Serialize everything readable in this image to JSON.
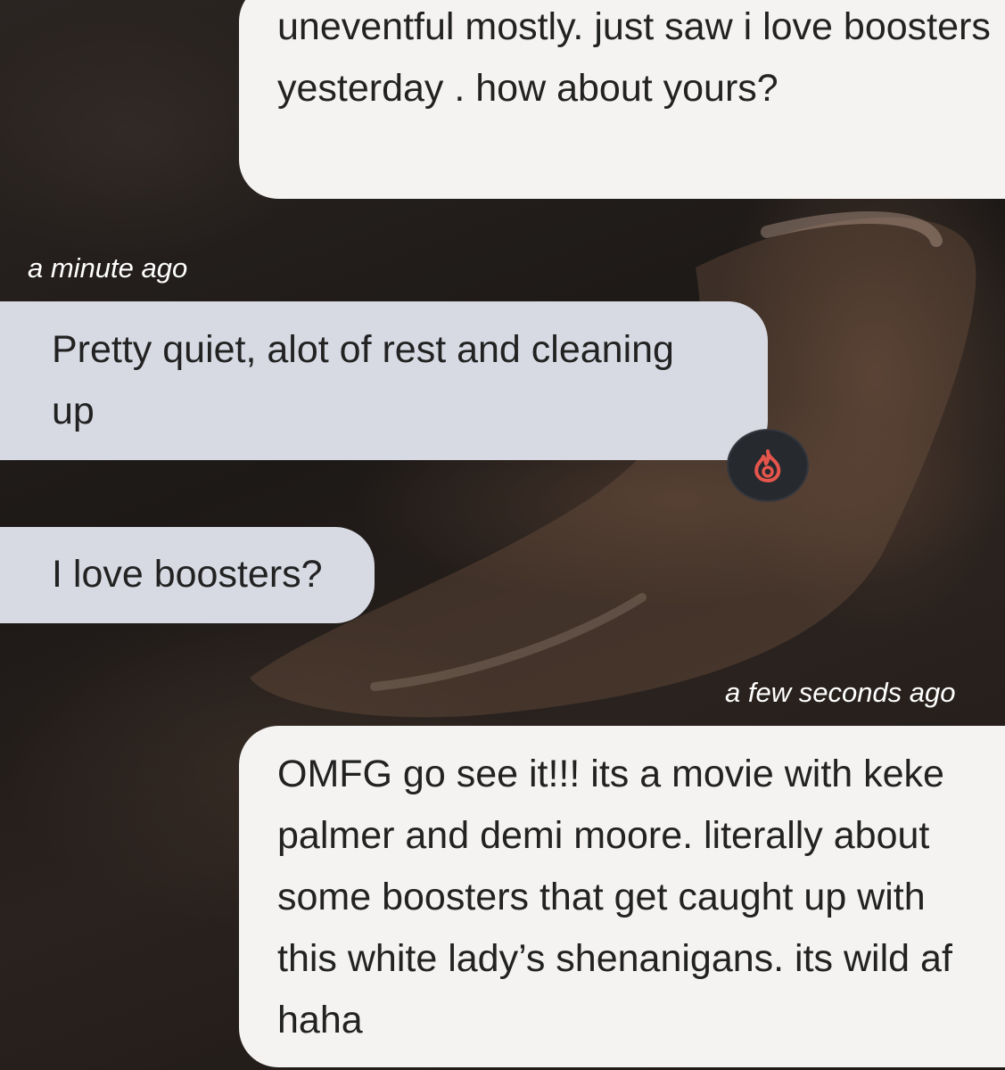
{
  "messages": [
    {
      "side": "sent",
      "text": "uneventful mostly. just saw i love boosters yesterday . how about yours?"
    },
    {
      "side": "received",
      "timestamp": "a minute ago",
      "text": "Pretty quiet, alot of rest and cleaning up",
      "reaction": "flame-icon"
    },
    {
      "side": "received",
      "text": "I love boosters?"
    },
    {
      "side": "sent",
      "timestamp": "a few seconds ago",
      "text": "OMFG go see it!!! its a movie with keke palmer and demi moore. literally about some boosters that get caught up with this white lady’s shenanigans. its wild af haha"
    }
  ],
  "colors": {
    "sent_bubble": "#f4f3f1",
    "received_bubble": "#d7dae3",
    "reaction_flame": "#e5554c",
    "reaction_badge": "#26292e"
  }
}
